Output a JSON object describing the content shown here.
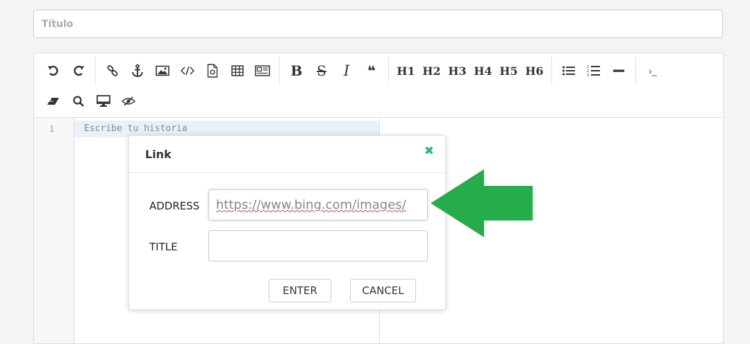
{
  "title_field": {
    "placeholder": "Título",
    "value": ""
  },
  "toolbar": {
    "row1": [
      {
        "name": "undo-icon",
        "glyph": "undo"
      },
      {
        "name": "redo-icon",
        "glyph": "redo"
      },
      {
        "sep": true
      },
      {
        "name": "link-icon",
        "glyph": "link"
      },
      {
        "name": "anchor-icon",
        "glyph": "anchor"
      },
      {
        "name": "image-icon",
        "glyph": "image"
      },
      {
        "name": "code-icon",
        "glyph": "code"
      },
      {
        "name": "code-block-icon",
        "glyph": "codeblock"
      },
      {
        "name": "table-icon",
        "glyph": "table"
      },
      {
        "name": "datetime-icon",
        "glyph": "datetime"
      },
      {
        "sep": true
      },
      {
        "name": "bold-button",
        "text": "B",
        "style": "serif-bold"
      },
      {
        "name": "strikethrough-button",
        "text": "S",
        "style": "strike"
      },
      {
        "name": "italic-button",
        "text": "I",
        "style": "serif-italic"
      },
      {
        "name": "quote-icon",
        "text": "❝",
        "style": "quote"
      },
      {
        "sep": true
      },
      {
        "name": "h1-button",
        "text": "H1",
        "style": "h"
      },
      {
        "name": "h2-button",
        "text": "H2",
        "style": "h"
      },
      {
        "name": "h3-button",
        "text": "H3",
        "style": "h"
      },
      {
        "name": "h4-button",
        "text": "H4",
        "style": "h"
      },
      {
        "name": "h5-button",
        "text": "H5",
        "style": "h"
      },
      {
        "name": "h6-button",
        "text": "H6",
        "style": "h"
      },
      {
        "sep": true
      },
      {
        "name": "bullet-list-icon",
        "glyph": "ul"
      },
      {
        "name": "ordered-list-icon",
        "glyph": "ol"
      },
      {
        "name": "horizontal-rule-icon",
        "glyph": "hr"
      },
      {
        "sep": true
      },
      {
        "name": "terminal-icon",
        "text": "›_",
        "style": "term"
      }
    ],
    "row2": [
      {
        "name": "eraser-icon",
        "glyph": "eraser"
      },
      {
        "name": "search-icon",
        "glyph": "search"
      },
      {
        "name": "preview-monitor-icon",
        "glyph": "monitor"
      },
      {
        "name": "hide-preview-icon",
        "glyph": "eyeslash"
      }
    ]
  },
  "editor": {
    "line_number": "1",
    "placeholder": "Escribe tu historia"
  },
  "dialog": {
    "title": "Link",
    "close_glyph": "✖",
    "address_label": "ADDRESS",
    "address_value": "https://www.bing.com/images/",
    "title_label": "TITLE",
    "title_value": "",
    "enter_label": "ENTER",
    "cancel_label": "CANCEL"
  },
  "colors": {
    "accent_close": "#2fb77a",
    "arrow": "#24ad48"
  }
}
